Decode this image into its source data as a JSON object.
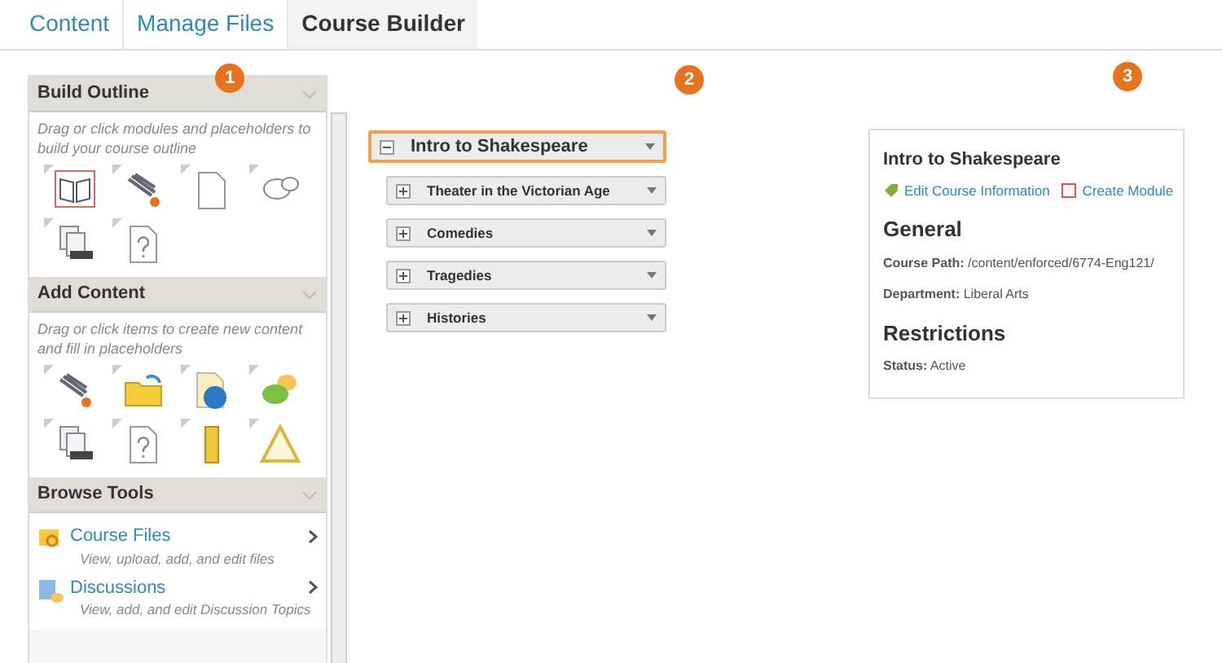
{
  "tabs": [
    {
      "label": "Content",
      "selected": false
    },
    {
      "label": "Manage Files",
      "selected": false
    },
    {
      "label": "Course Builder",
      "selected": true
    }
  ],
  "callouts": [
    "1",
    "2",
    "3"
  ],
  "sidebar": {
    "sections": [
      {
        "title": "Build Outline",
        "kind": "tiles",
        "description": "Drag or click modules and placeholders to build your course outline"
      },
      {
        "title": "Add Content",
        "kind": "tiles",
        "description": "Drag or click items to create new content and fill in placeholders"
      },
      {
        "title": "Browse Tools",
        "kind": "tools",
        "tools": [
          {
            "label": "Course Files",
            "description": "View, upload, add, and edit files"
          },
          {
            "label": "Discussions",
            "description": "View, add, and edit Discussion Topics"
          }
        ]
      }
    ]
  },
  "outline": {
    "title": "Intro to Shakespeare",
    "expanded": true,
    "selected": true,
    "children": [
      {
        "title": "Theater in the Victorian Age",
        "expanded": false,
        "selected": false
      },
      {
        "title": "Comedies",
        "expanded": false,
        "selected": false
      },
      {
        "title": "Tragedies",
        "expanded": false,
        "selected": false
      },
      {
        "title": "Histories",
        "expanded": false,
        "selected": false
      }
    ]
  },
  "details": {
    "title": "Intro to Shakespeare",
    "links": [
      "Edit Course Information",
      "Create Module"
    ],
    "sections": [
      {
        "heading": "General",
        "fields": [
          "**Course Path:** /content/enforced/6774-Eng121/",
          "**Department:** Liberal Arts"
        ]
      },
      {
        "heading": "Restrictions",
        "fields": [
          "**Status:** Active"
        ]
      }
    ]
  }
}
